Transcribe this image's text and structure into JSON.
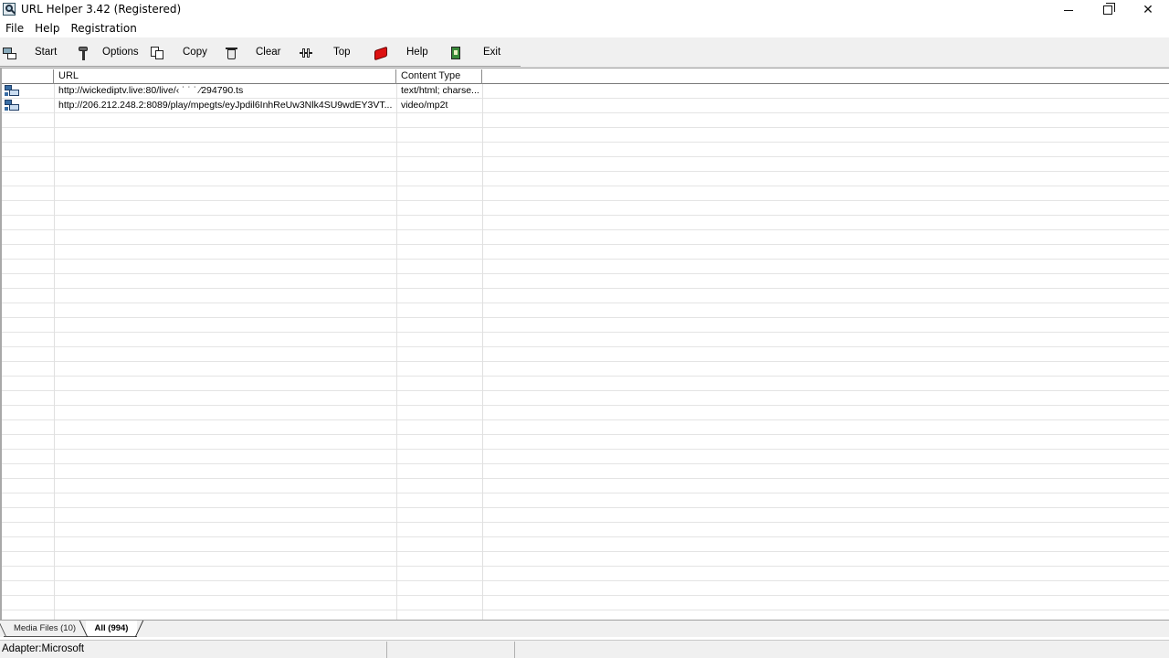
{
  "window": {
    "title": "URL Helper 3.42 (Registered)",
    "controls": {
      "minimize": "minimize-icon",
      "restore": "restore-icon",
      "close": "close-icon"
    }
  },
  "menu": {
    "items": [
      "File",
      "Help",
      "Registration"
    ]
  },
  "toolbar": {
    "start": "Start",
    "options": "Options",
    "copy": "Copy",
    "clear": "Clear",
    "top": "Top",
    "help": "Help",
    "exit": "Exit"
  },
  "list": {
    "columns": [
      "",
      "URL",
      "Content Type"
    ],
    "rows": [
      {
        "url": "http://wickediptv.live:80/live/‹     ˙    ˙         ˙     ⁄294790.ts",
        "content_type": "text/html; charse..."
      },
      {
        "url": "http://206.212.248.2:8089/play/mpegts/eyJpdil6InhReUw3Nlk4SU9wdEY3VT...",
        "content_type": "video/mp2t"
      }
    ]
  },
  "tabs": {
    "media": "Media Files (10)",
    "all": "All (994)"
  },
  "statusbar": {
    "panel1": "Adapter:Microsoft",
    "panel2": "",
    "panel3": ""
  },
  "colors": {
    "toolbar_bg": "#f0f0f0",
    "grid_line": "#e4e4e4",
    "help_icon": "#dd1111",
    "exit_icon": "#3a8a3a"
  }
}
